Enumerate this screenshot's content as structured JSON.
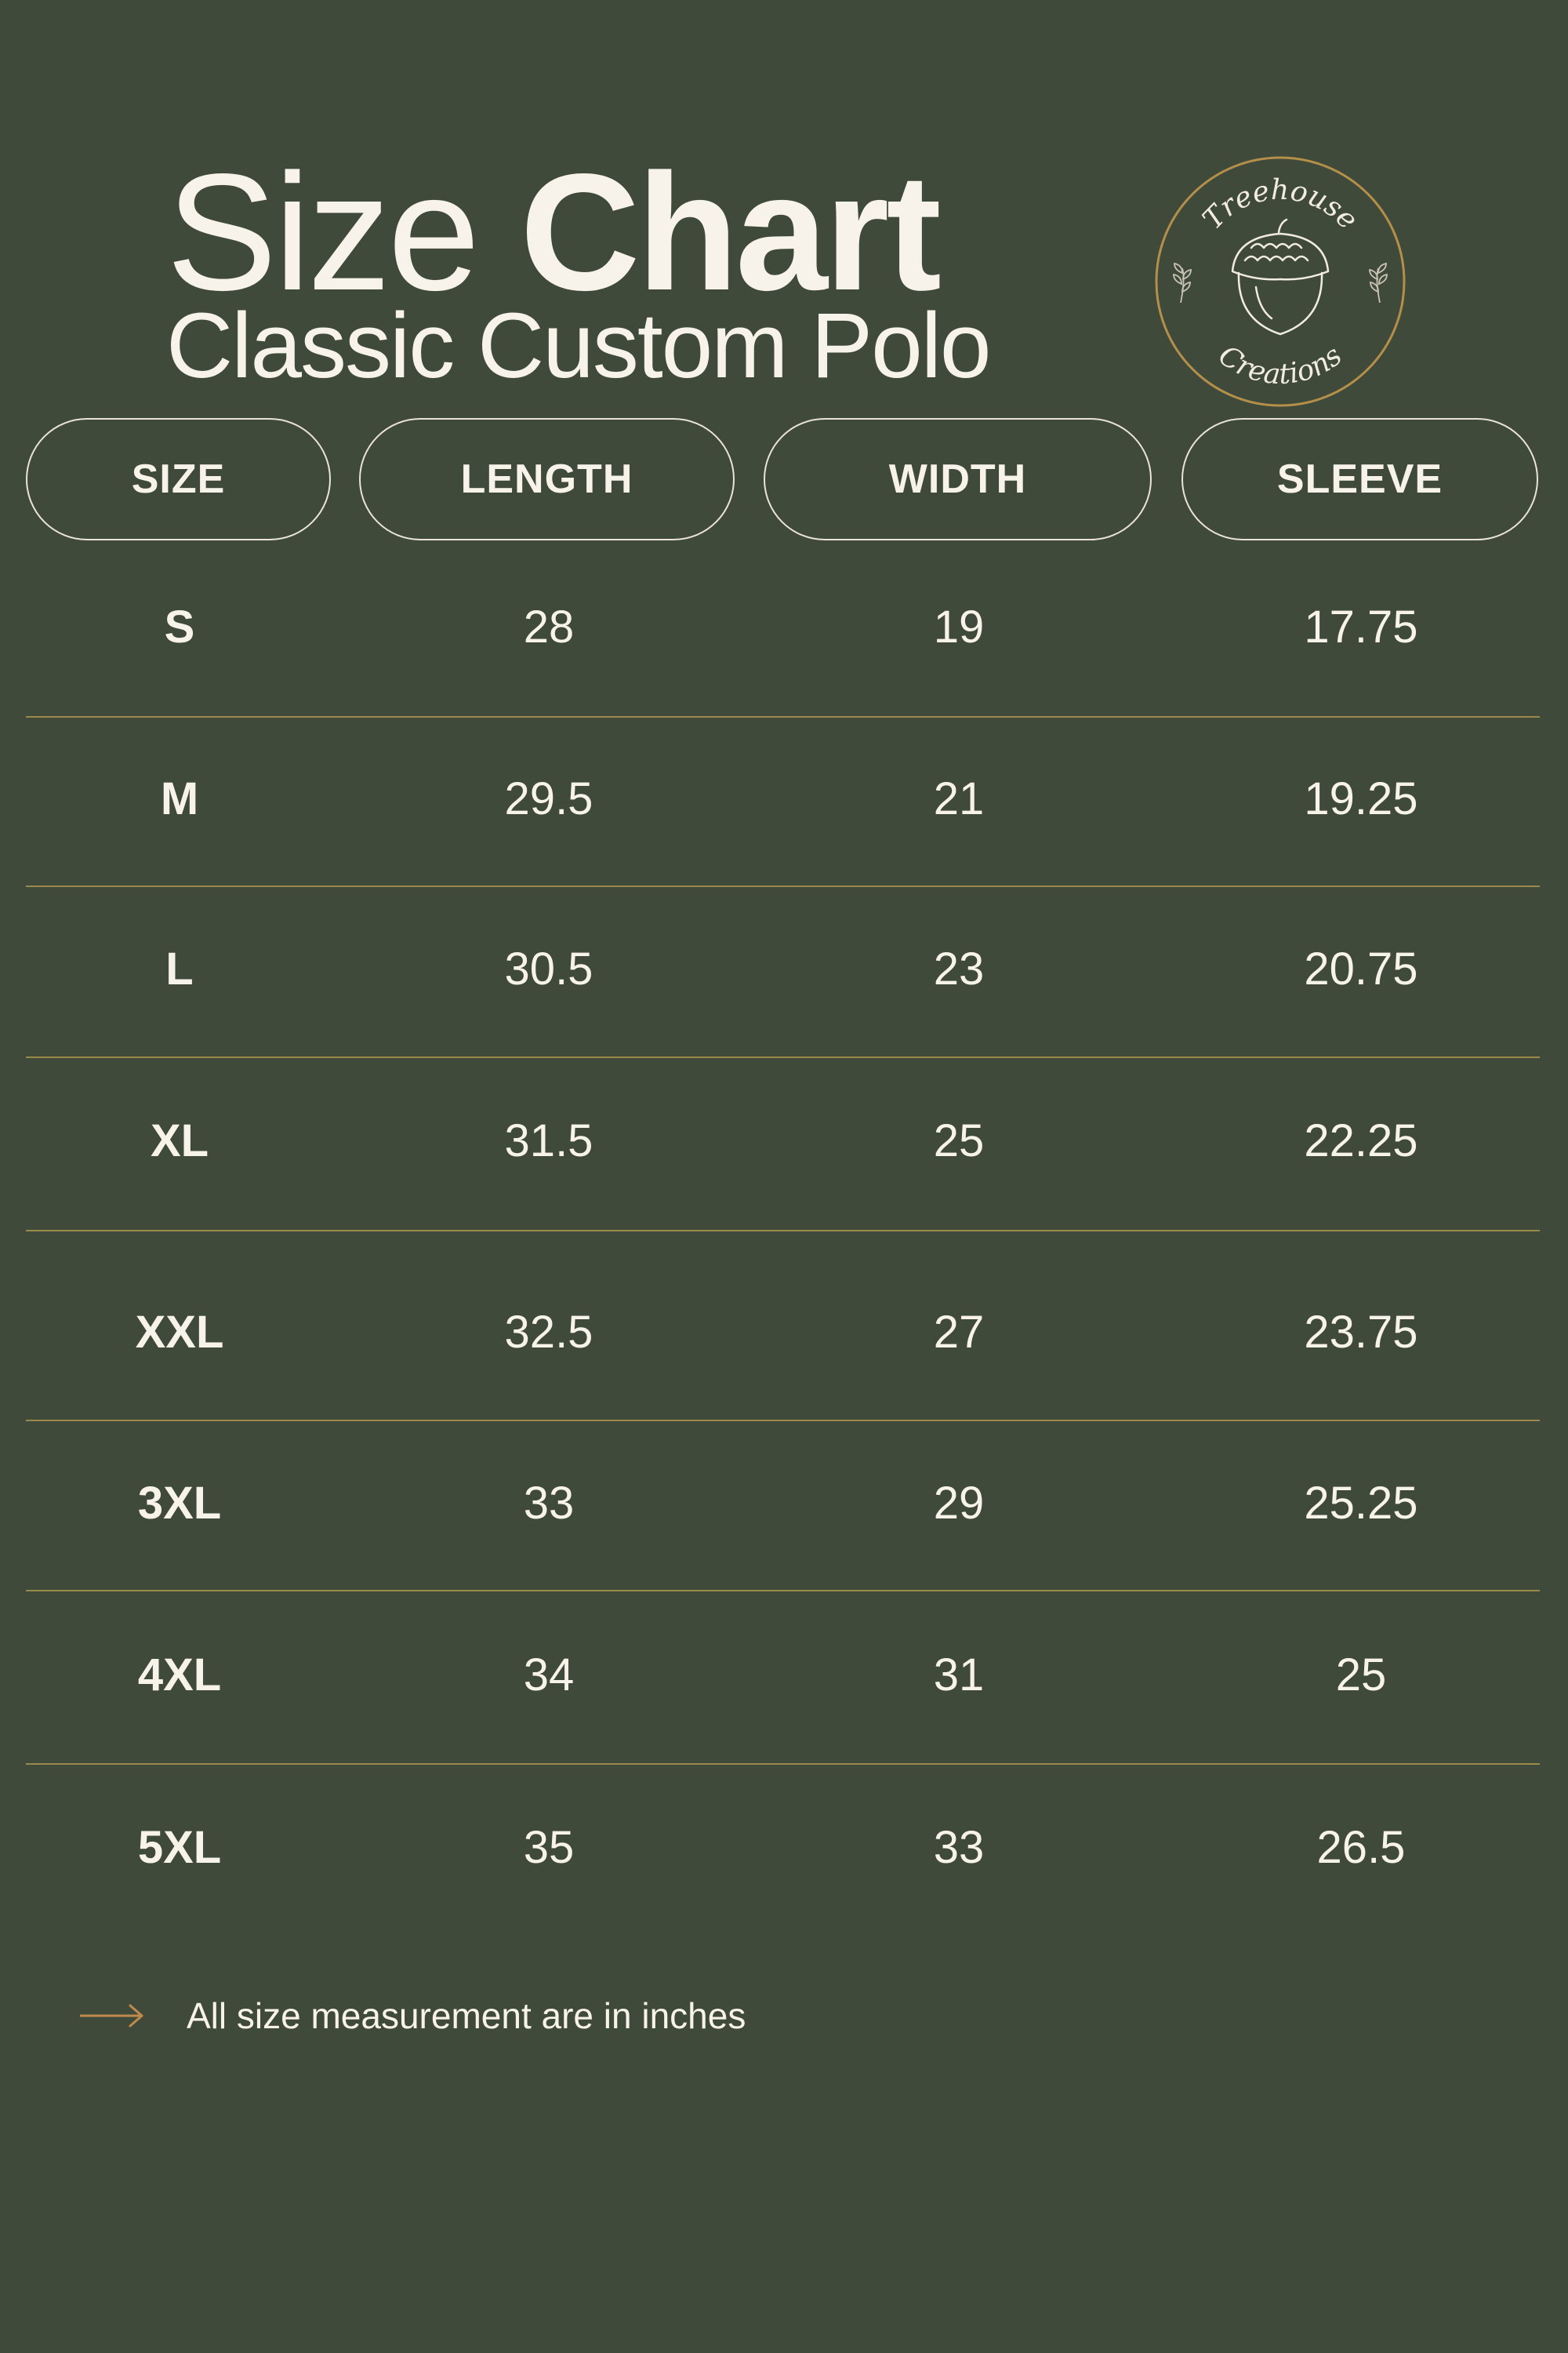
{
  "title": {
    "light": "Size",
    "bold": "Chart",
    "subtitle": "Classic Custom Polo"
  },
  "logo": {
    "top_text": "Treehouse",
    "bottom_text": "Creations",
    "icon": "acorn-icon",
    "ring_color": "#b48f4a"
  },
  "headers": [
    "SIZE",
    "LENGTH",
    "WIDTH",
    "SLEEVE"
  ],
  "rows": [
    {
      "size": "S",
      "length": "28",
      "width": "19",
      "sleeve": "17.75"
    },
    {
      "size": "M",
      "length": "29.5",
      "width": "21",
      "sleeve": "19.25"
    },
    {
      "size": "L",
      "length": "30.5",
      "width": "23",
      "sleeve": "20.75"
    },
    {
      "size": "XL",
      "length": "31.5",
      "width": "25",
      "sleeve": "22.25"
    },
    {
      "size": "XXL",
      "length": "32.5",
      "width": "27",
      "sleeve": "23.75"
    },
    {
      "size": "3XL",
      "length": "33",
      "width": "29",
      "sleeve": "25.25"
    },
    {
      "size": "4XL",
      "length": "34",
      "width": "31",
      "sleeve": "25"
    },
    {
      "size": "5XL",
      "length": "35",
      "width": "33",
      "sleeve": "26.5"
    }
  ],
  "note": {
    "icon": "arrow-right-icon",
    "text": "All size measurement are in inches"
  },
  "colors": {
    "background": "#404a3b",
    "text": "#f7f3ea",
    "divider": "#9b8a4a",
    "accent": "#c08a4c"
  }
}
